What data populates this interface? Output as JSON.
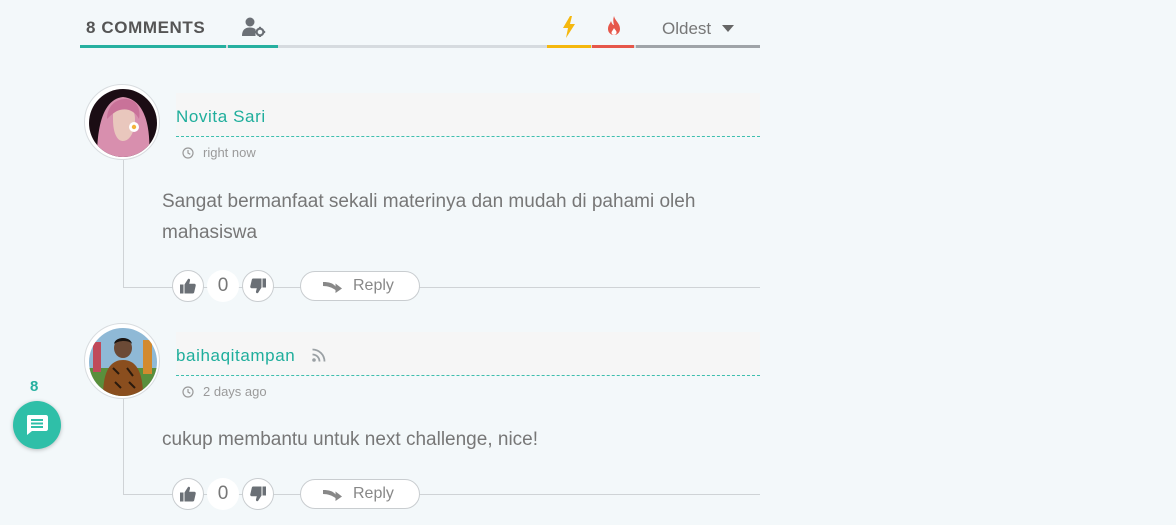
{
  "header": {
    "comments_label": "8 COMMENTS",
    "sort_label": "Oldest",
    "icons": [
      "user-settings-icon",
      "bolt-icon",
      "fire-icon",
      "caret-down-icon"
    ],
    "colors": {
      "accent": "#26b0a0",
      "bolt": "#f5b80e",
      "fire": "#e6574a"
    }
  },
  "comments": [
    {
      "author": "Novita Sari",
      "time": "right now",
      "text": "Sangat bermanfaat sekali materinya dan mudah di pahami oleh mahasiswa",
      "votes": "0",
      "reply_label": "Reply"
    },
    {
      "author": "baihaqitampan",
      "time": "2 days ago",
      "text": "cukup membantu untuk next challenge, nice!",
      "votes": "0",
      "reply_label": "Reply"
    }
  ],
  "bubble": {
    "count": "8",
    "icon": "comment-icon"
  }
}
